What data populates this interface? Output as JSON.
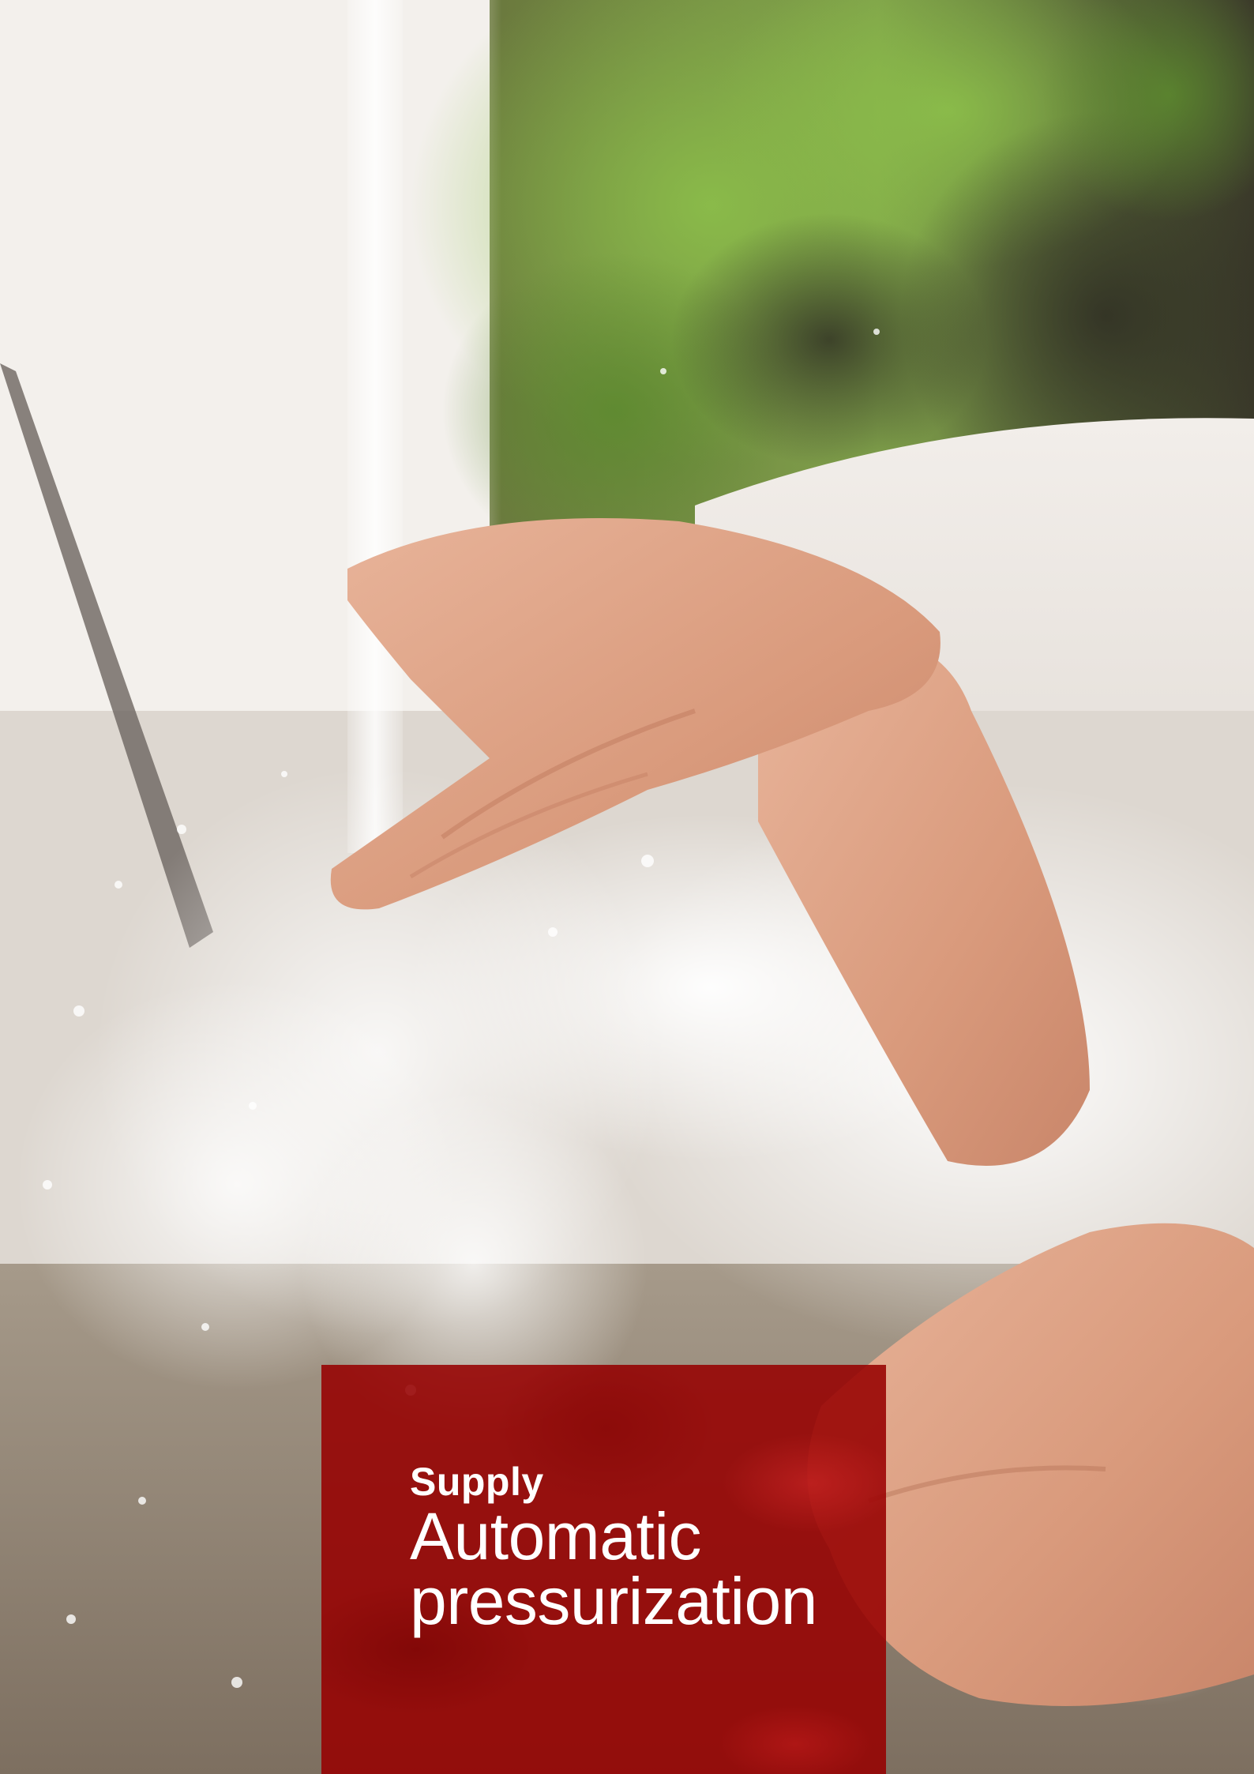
{
  "overlay": {
    "eyebrow": "Supply",
    "title_line_1": "Automatic",
    "title_line_2": "pressurization"
  },
  "colors": {
    "panel": "#960000",
    "text": "#ffffff"
  }
}
